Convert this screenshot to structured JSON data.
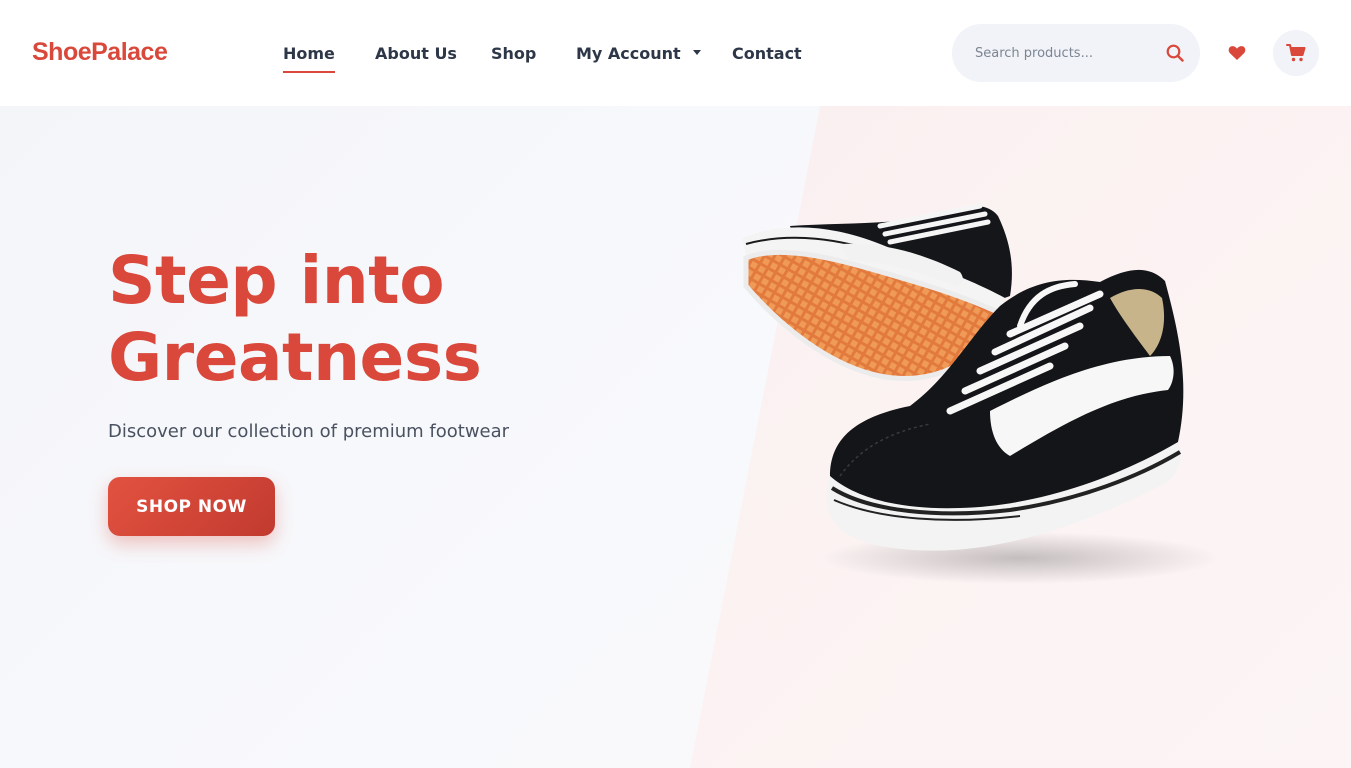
{
  "brand": {
    "name": "ShoePalace",
    "color": "#d9483b"
  },
  "nav": {
    "items": [
      {
        "label": "Home",
        "active": true
      },
      {
        "label": "About Us"
      },
      {
        "label": "Shop"
      },
      {
        "label": "My Account",
        "dropdown": true
      },
      {
        "label": "Contact"
      }
    ]
  },
  "search": {
    "placeholder": "Search products...",
    "icon": "search-icon"
  },
  "actions": {
    "wishlist_icon": "heart-icon",
    "cart_icon": "cart-icon"
  },
  "hero": {
    "title_line1": "Step into",
    "title_line2": "Greatness",
    "subtitle": "Discover our collection of premium footwear",
    "cta_label": "SHOP NOW",
    "image": "black-and-white-sneakers"
  },
  "colors": {
    "accent": "#d9483b",
    "text": "#2d3748",
    "background": "#f7f8fb"
  }
}
